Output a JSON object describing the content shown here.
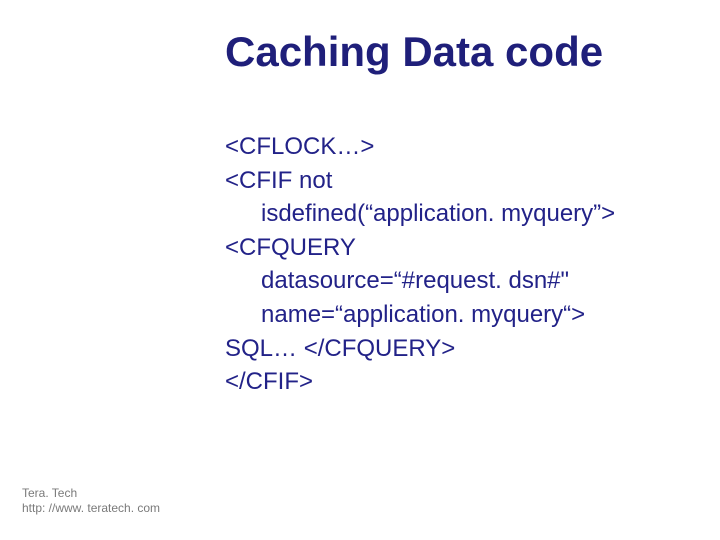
{
  "slide": {
    "title": "Caching Data code"
  },
  "code": {
    "l1": "<CFLOCK…>",
    "l2": "<CFIF not",
    "l3": "isdefined(“application. myquery”>",
    "l4": "<CFQUERY",
    "l5": "datasource=“#request. dsn#\"",
    "l6": "name=“application. myquery“>",
    "l7": "SQL… </CFQUERY>",
    "l8": "</CFIF>"
  },
  "footer": {
    "name": "Tera. Tech",
    "url": "http: //www. teratech. com"
  }
}
